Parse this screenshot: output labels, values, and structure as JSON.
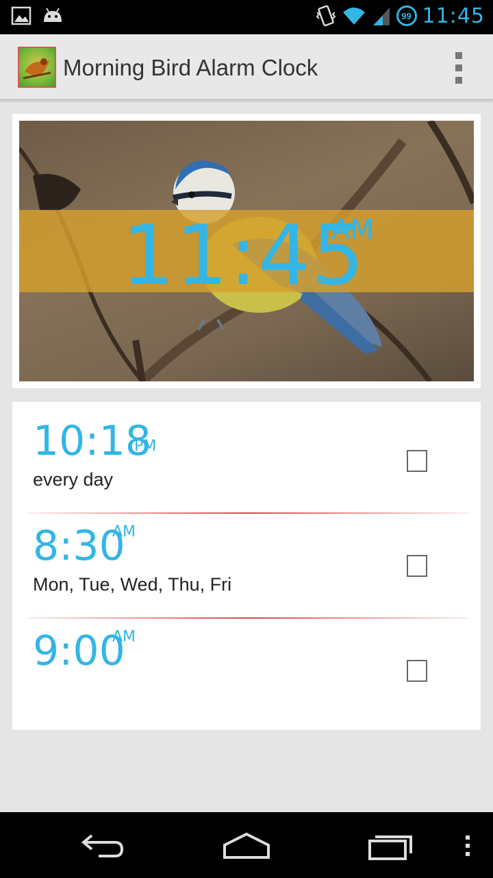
{
  "status_bar": {
    "time": "11:45",
    "notification_badge": "99",
    "icons": [
      "gallery-icon",
      "android-icon",
      "vibrate-icon",
      "wifi-icon",
      "signal-icon"
    ]
  },
  "action_bar": {
    "title": "Morning Bird Alarm Clock",
    "app_icon": "bird-app-icon",
    "overflow_icon": "overflow-menu-icon"
  },
  "clock": {
    "time": "11:45",
    "ampm": "AM"
  },
  "alarms": [
    {
      "time": "10:18",
      "ampm": "PM",
      "days": "every day",
      "enabled": false
    },
    {
      "time": "8:30",
      "ampm": "AM",
      "days": "Mon, Tue, Wed, Thu, Fri",
      "enabled": false
    },
    {
      "time": "9:00",
      "ampm": "AM",
      "days": "",
      "enabled": false
    }
  ],
  "nav_bar": {
    "icons": [
      "back-icon",
      "home-icon",
      "recent-apps-icon",
      "menu-icon"
    ]
  },
  "colors": {
    "accent": "#33b5e5",
    "band": "#d6a02d",
    "divider": "#dd4444"
  }
}
